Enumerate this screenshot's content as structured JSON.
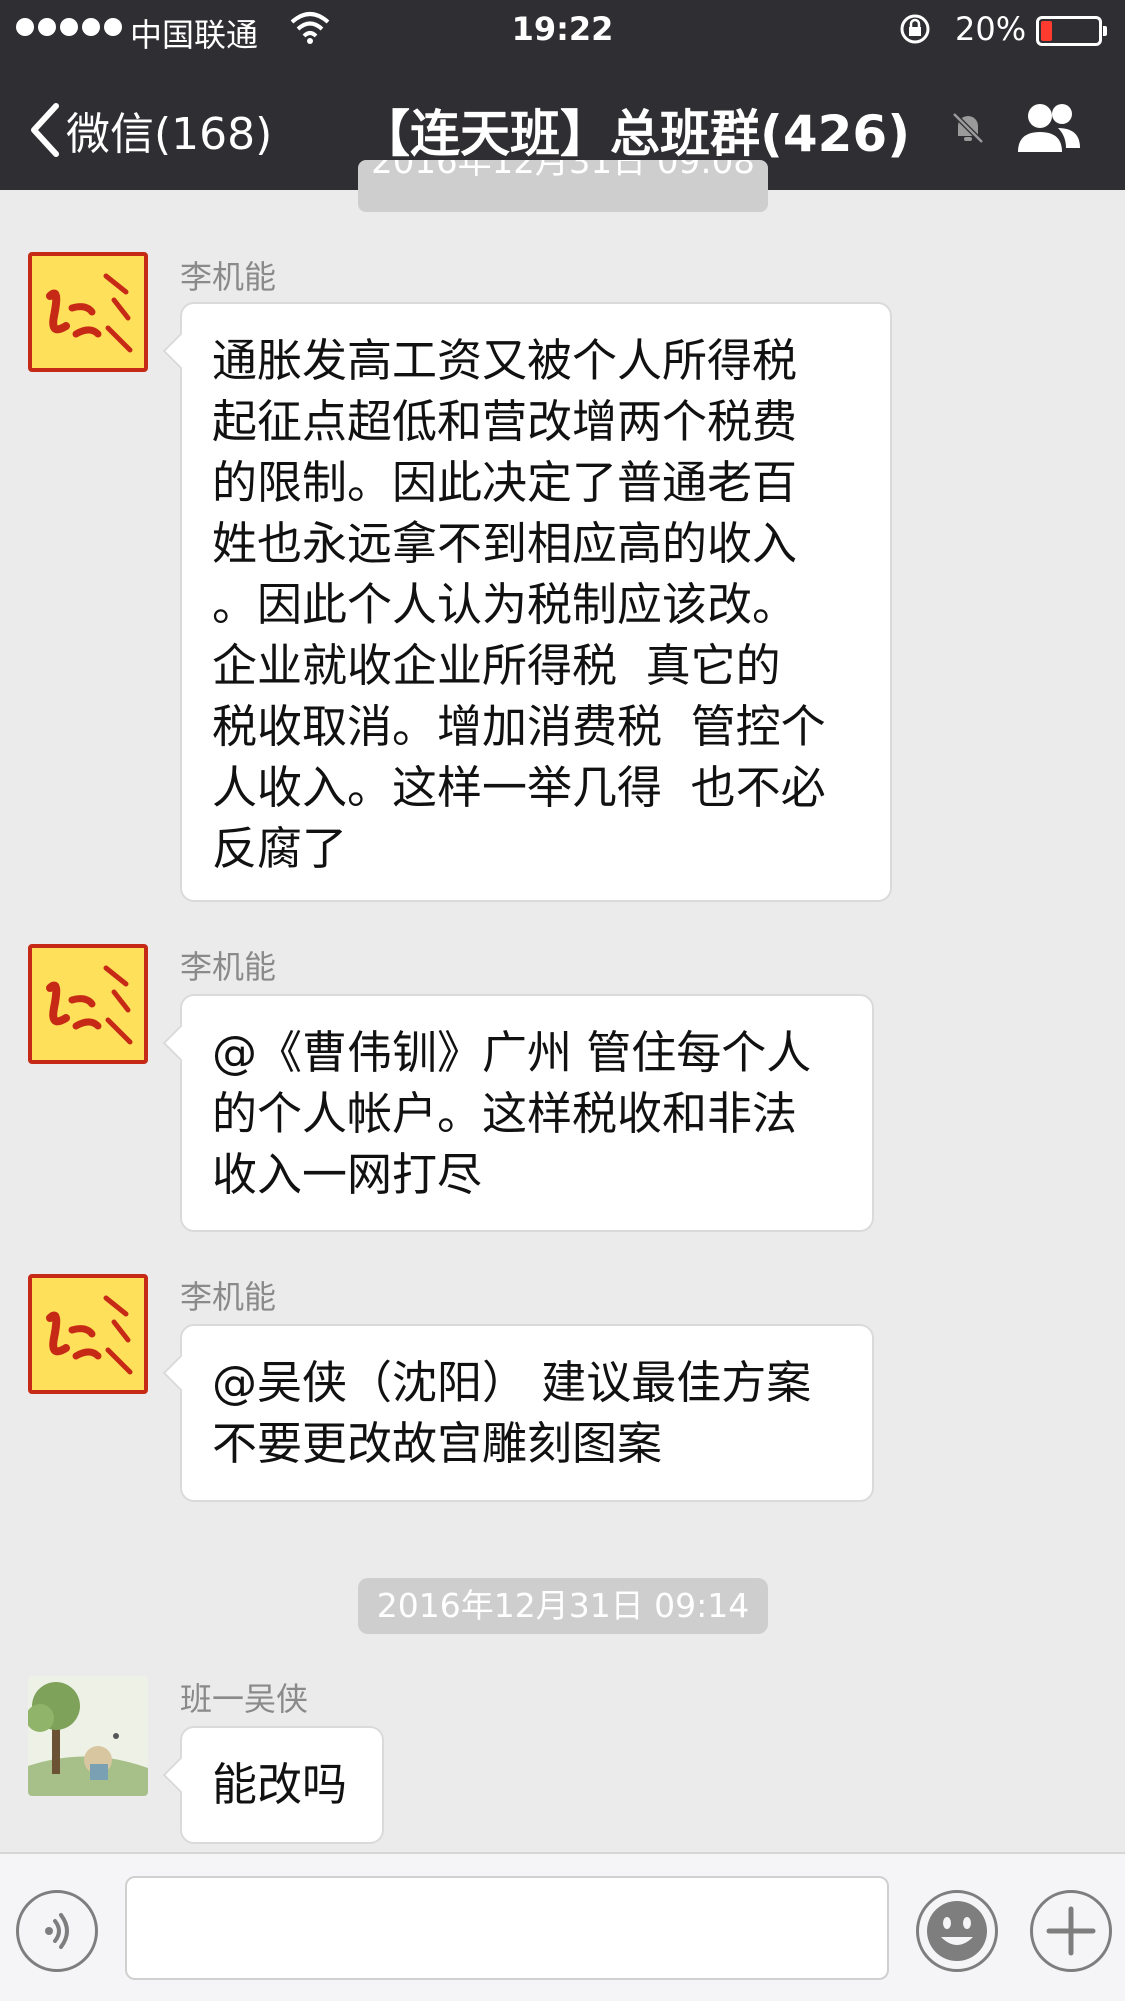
{
  "status_bar": {
    "carrier": "中国联通",
    "time": "19:22",
    "battery": "20%",
    "battery_level": 0.2
  },
  "nav": {
    "back_label": "微信(168)",
    "title": "【连天班】总班群(426)"
  },
  "chat": {
    "hidden_timestamp": "2016年12月31日 09:08",
    "messages": [
      {
        "sender": "李机能",
        "lines": [
          "通胀发高工资又被个人所得税",
          "起征点超低和营改增两个税费",
          "的限制。因此决定了普通老百",
          "姓也永远拿不到相应高的收入",
          "。因此个人认为税制应该改。",
          "企业就收企业所得税  真它的",
          "税收取消。增加消费税  管控个",
          "人收入。这样一举几得  也不必",
          "反腐了"
        ]
      },
      {
        "sender": "李机能",
        "lines": [
          "@《曹伟钏》广州 管住每个人",
          "的个人帐户。这样税收和非法",
          "收入一网打尽"
        ]
      },
      {
        "sender": "李机能",
        "lines": [
          "@吴侠（沈阳） 建议最佳方案",
          "不要更改故宫雕刻图案"
        ]
      },
      {
        "sender": "班一吴侠",
        "lines": [
          "能改吗"
        ]
      }
    ],
    "timestamp": "2016年12月31日 09:14"
  },
  "input_bar": {
    "value": "",
    "icons": [
      "voice-icon",
      "emoji-icon",
      "plus-icon"
    ]
  },
  "colors": {
    "nav_bg": "#2e2e33",
    "chat_bg": "#ebebeb",
    "bubble_bg": "#ffffff",
    "battery_low": "#ff3b30"
  }
}
